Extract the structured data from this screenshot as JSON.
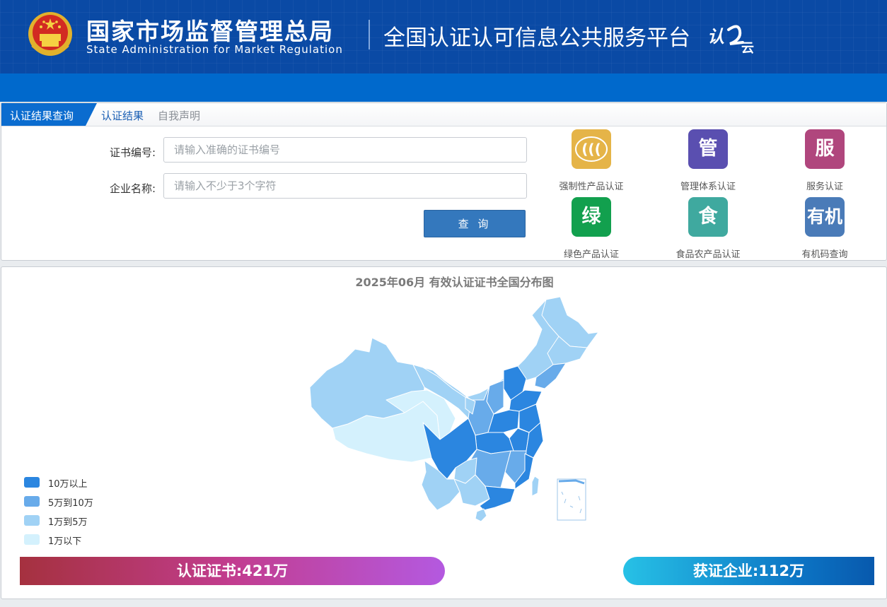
{
  "header": {
    "org_name_cn": "国家市场监督管理总局",
    "org_name_en": "State Administration  for  Market Regulation",
    "platform_title": "全国认证认可信息公共服务平台",
    "logo_icon": "national-emblem",
    "rz_logo_icon": "renzheng-yun-logo"
  },
  "tabs": {
    "active": "认证结果查询",
    "items": [
      "认证结果",
      "自我声明"
    ]
  },
  "form": {
    "cert_label": "证书编号:",
    "cert_placeholder": "请输入准确的证书编号",
    "cert_value": "",
    "company_label": "企业名称:",
    "company_placeholder": "请输入不少于3个字符",
    "company_value": "",
    "query_button": "查 询"
  },
  "services": [
    {
      "label": "强制性产品认证",
      "glyph": "",
      "icon": "ccc-icon",
      "color": "#e5b448"
    },
    {
      "label": "管理体系认证",
      "glyph": "管",
      "icon": "management-icon",
      "color": "#5a4fb0"
    },
    {
      "label": "服务认证",
      "glyph": "服",
      "icon": "service-icon",
      "color": "#b0467d"
    },
    {
      "label": "绿色产品认证",
      "glyph": "绿",
      "icon": "green-icon",
      "color": "#12a04e"
    },
    {
      "label": "食品农产品认证",
      "glyph": "食",
      "icon": "food-icon",
      "color": "#3fa99f"
    },
    {
      "label": "有机码查询",
      "glyph": "有机",
      "icon": "organic-icon",
      "color": "#4a7bb8"
    }
  ],
  "map": {
    "title": "2025年06月  有效认证证书全国分布图",
    "legend": [
      {
        "label": "10万以上",
        "color": "#2b86e0"
      },
      {
        "label": "5万到10万",
        "color": "#68abea"
      },
      {
        "label": "1万到5万",
        "color": "#a0d2f5"
      },
      {
        "label": "1万以下",
        "color": "#d4f1fd"
      }
    ]
  },
  "stats": {
    "certificates": "认证证书:421万",
    "companies": "获证企业:112万"
  }
}
